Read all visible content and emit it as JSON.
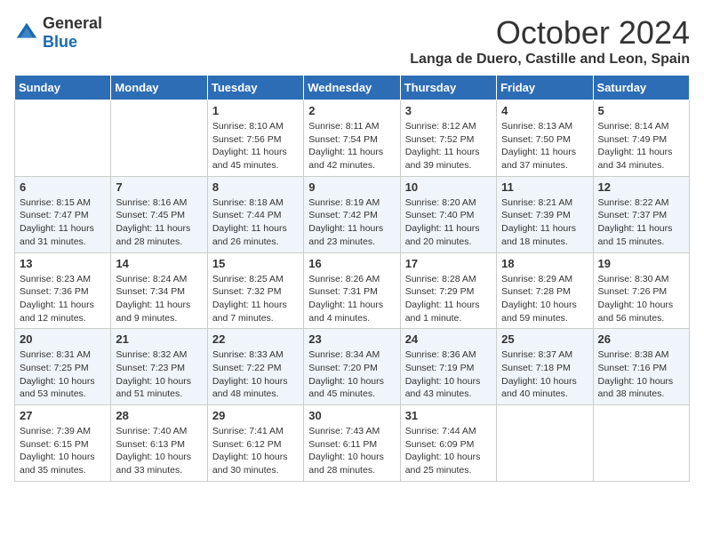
{
  "header": {
    "logo_general": "General",
    "logo_blue": "Blue",
    "month_title": "October 2024",
    "location": "Langa de Duero, Castille and Leon, Spain"
  },
  "days_of_week": [
    "Sunday",
    "Monday",
    "Tuesday",
    "Wednesday",
    "Thursday",
    "Friday",
    "Saturday"
  ],
  "weeks": [
    [
      {
        "day": "",
        "info": ""
      },
      {
        "day": "",
        "info": ""
      },
      {
        "day": "1",
        "info": "Sunrise: 8:10 AM\nSunset: 7:56 PM\nDaylight: 11 hours and 45 minutes."
      },
      {
        "day": "2",
        "info": "Sunrise: 8:11 AM\nSunset: 7:54 PM\nDaylight: 11 hours and 42 minutes."
      },
      {
        "day": "3",
        "info": "Sunrise: 8:12 AM\nSunset: 7:52 PM\nDaylight: 11 hours and 39 minutes."
      },
      {
        "day": "4",
        "info": "Sunrise: 8:13 AM\nSunset: 7:50 PM\nDaylight: 11 hours and 37 minutes."
      },
      {
        "day": "5",
        "info": "Sunrise: 8:14 AM\nSunset: 7:49 PM\nDaylight: 11 hours and 34 minutes."
      }
    ],
    [
      {
        "day": "6",
        "info": "Sunrise: 8:15 AM\nSunset: 7:47 PM\nDaylight: 11 hours and 31 minutes."
      },
      {
        "day": "7",
        "info": "Sunrise: 8:16 AM\nSunset: 7:45 PM\nDaylight: 11 hours and 28 minutes."
      },
      {
        "day": "8",
        "info": "Sunrise: 8:18 AM\nSunset: 7:44 PM\nDaylight: 11 hours and 26 minutes."
      },
      {
        "day": "9",
        "info": "Sunrise: 8:19 AM\nSunset: 7:42 PM\nDaylight: 11 hours and 23 minutes."
      },
      {
        "day": "10",
        "info": "Sunrise: 8:20 AM\nSunset: 7:40 PM\nDaylight: 11 hours and 20 minutes."
      },
      {
        "day": "11",
        "info": "Sunrise: 8:21 AM\nSunset: 7:39 PM\nDaylight: 11 hours and 18 minutes."
      },
      {
        "day": "12",
        "info": "Sunrise: 8:22 AM\nSunset: 7:37 PM\nDaylight: 11 hours and 15 minutes."
      }
    ],
    [
      {
        "day": "13",
        "info": "Sunrise: 8:23 AM\nSunset: 7:36 PM\nDaylight: 11 hours and 12 minutes."
      },
      {
        "day": "14",
        "info": "Sunrise: 8:24 AM\nSunset: 7:34 PM\nDaylight: 11 hours and 9 minutes."
      },
      {
        "day": "15",
        "info": "Sunrise: 8:25 AM\nSunset: 7:32 PM\nDaylight: 11 hours and 7 minutes."
      },
      {
        "day": "16",
        "info": "Sunrise: 8:26 AM\nSunset: 7:31 PM\nDaylight: 11 hours and 4 minutes."
      },
      {
        "day": "17",
        "info": "Sunrise: 8:28 AM\nSunset: 7:29 PM\nDaylight: 11 hours and 1 minute."
      },
      {
        "day": "18",
        "info": "Sunrise: 8:29 AM\nSunset: 7:28 PM\nDaylight: 10 hours and 59 minutes."
      },
      {
        "day": "19",
        "info": "Sunrise: 8:30 AM\nSunset: 7:26 PM\nDaylight: 10 hours and 56 minutes."
      }
    ],
    [
      {
        "day": "20",
        "info": "Sunrise: 8:31 AM\nSunset: 7:25 PM\nDaylight: 10 hours and 53 minutes."
      },
      {
        "day": "21",
        "info": "Sunrise: 8:32 AM\nSunset: 7:23 PM\nDaylight: 10 hours and 51 minutes."
      },
      {
        "day": "22",
        "info": "Sunrise: 8:33 AM\nSunset: 7:22 PM\nDaylight: 10 hours and 48 minutes."
      },
      {
        "day": "23",
        "info": "Sunrise: 8:34 AM\nSunset: 7:20 PM\nDaylight: 10 hours and 45 minutes."
      },
      {
        "day": "24",
        "info": "Sunrise: 8:36 AM\nSunset: 7:19 PM\nDaylight: 10 hours and 43 minutes."
      },
      {
        "day": "25",
        "info": "Sunrise: 8:37 AM\nSunset: 7:18 PM\nDaylight: 10 hours and 40 minutes."
      },
      {
        "day": "26",
        "info": "Sunrise: 8:38 AM\nSunset: 7:16 PM\nDaylight: 10 hours and 38 minutes."
      }
    ],
    [
      {
        "day": "27",
        "info": "Sunrise: 7:39 AM\nSunset: 6:15 PM\nDaylight: 10 hours and 35 minutes."
      },
      {
        "day": "28",
        "info": "Sunrise: 7:40 AM\nSunset: 6:13 PM\nDaylight: 10 hours and 33 minutes."
      },
      {
        "day": "29",
        "info": "Sunrise: 7:41 AM\nSunset: 6:12 PM\nDaylight: 10 hours and 30 minutes."
      },
      {
        "day": "30",
        "info": "Sunrise: 7:43 AM\nSunset: 6:11 PM\nDaylight: 10 hours and 28 minutes."
      },
      {
        "day": "31",
        "info": "Sunrise: 7:44 AM\nSunset: 6:09 PM\nDaylight: 10 hours and 25 minutes."
      },
      {
        "day": "",
        "info": ""
      },
      {
        "day": "",
        "info": ""
      }
    ]
  ]
}
